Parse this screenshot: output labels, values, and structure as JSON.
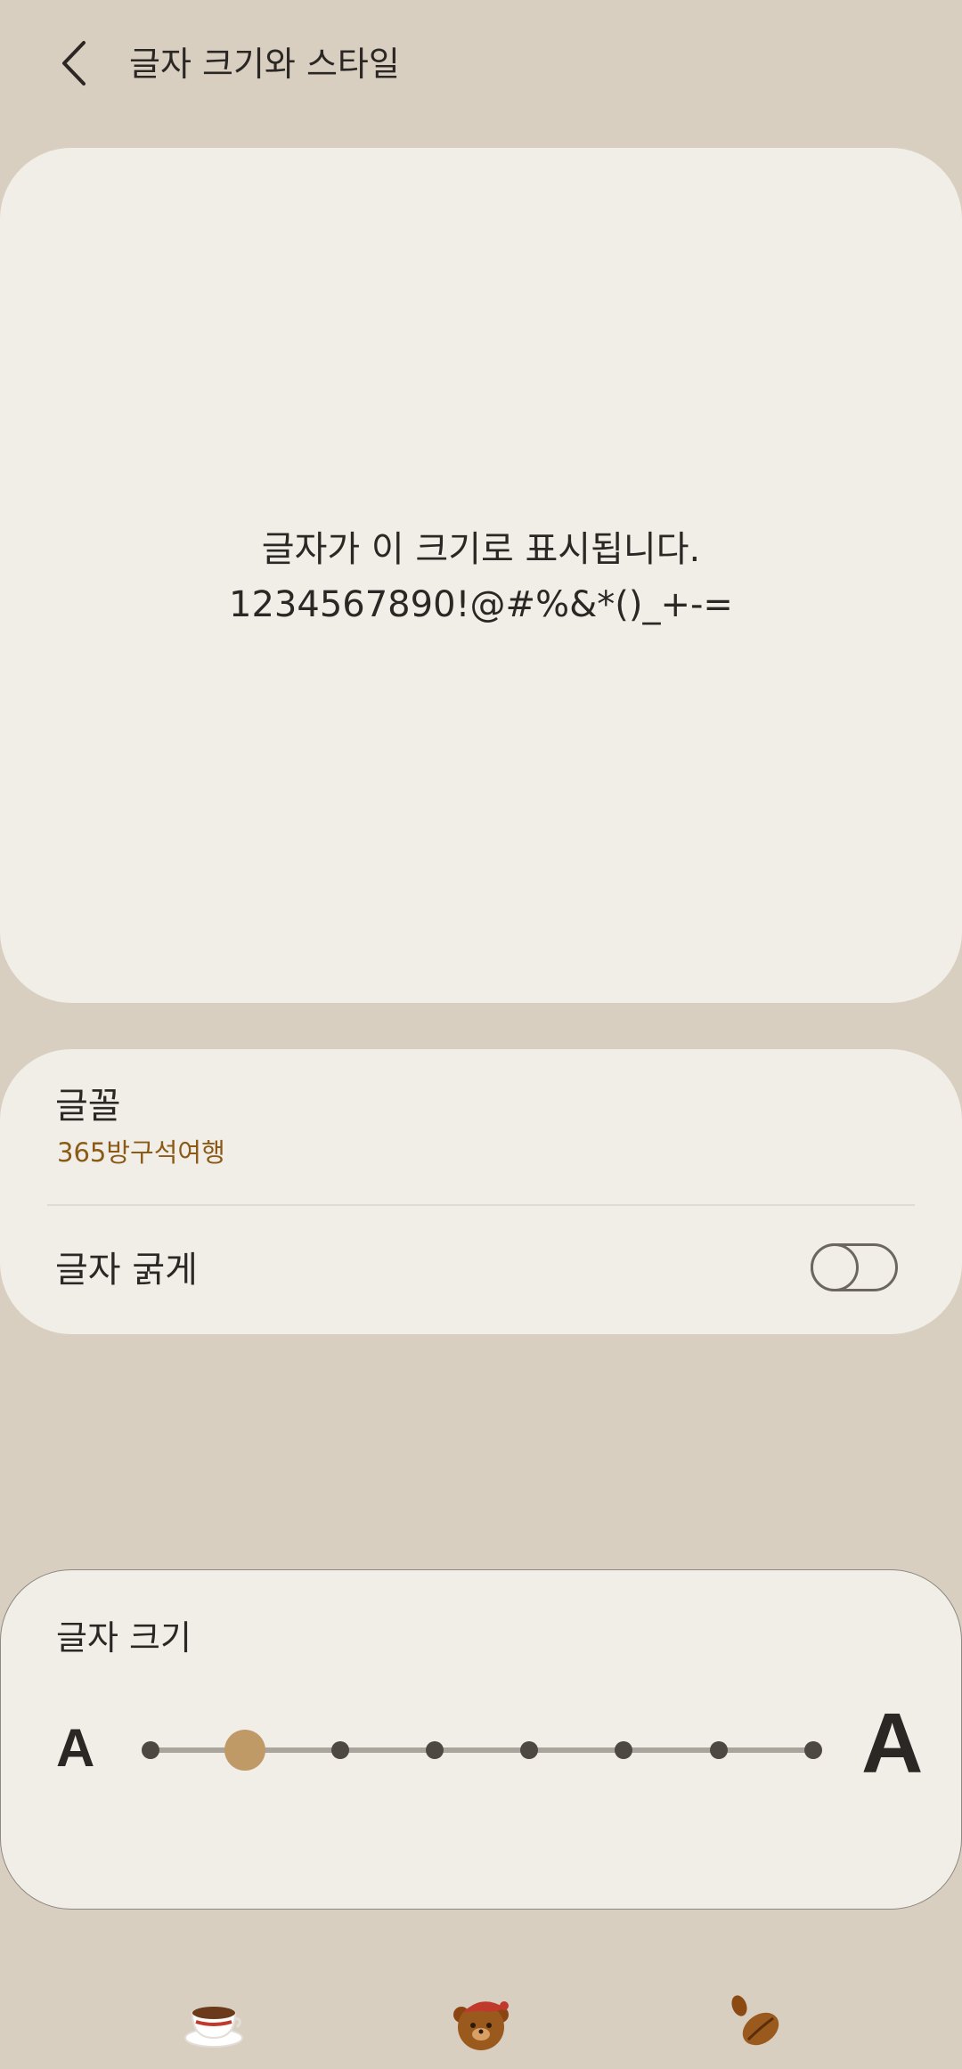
{
  "header": {
    "title": "글자 크기와 스타일"
  },
  "preview": {
    "line1": "글자가 이 크기로 표시됩니다.",
    "line2": "1234567890!@#%&*()_+-="
  },
  "font": {
    "title": "글꼴",
    "value": "365방구석여행"
  },
  "bold": {
    "label": "글자 굵게",
    "enabled": false
  },
  "size": {
    "title": "글자 크기",
    "small_label": "A",
    "large_label": "A",
    "steps": 8,
    "selected_index": 1
  },
  "nav": {
    "icons": [
      "coffee-cup-icon",
      "bear-icon",
      "coffee-beans-icon"
    ]
  },
  "colors": {
    "background": "#d9cfc1",
    "card": "#f1eee8",
    "accent": "#c09a66",
    "font_value": "#8b5a17"
  }
}
